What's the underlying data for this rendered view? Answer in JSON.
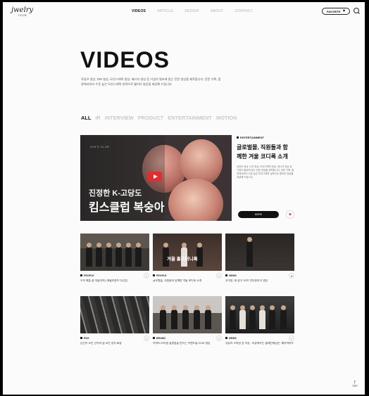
{
  "nav": {
    "logo": "jwelry",
    "logo_sub": "CLUB",
    "items": [
      "VIDEOS",
      "ARTICLE",
      "DESIGN",
      "ABOUT",
      "CONTACT"
    ],
    "active": "VIDEOS",
    "favorite_label": "FAVORITE",
    "favorite_icon": "heart-icon",
    "search_icon": "search-icon"
  },
  "hero": {
    "title": "VIDEOS",
    "description": "유튜브 영상, DID 영상, 모션그래픽 영상, 메시지 영상 등 기업의 필요에 맞는 전문 영상을 제작합니다. 전문 기획, 촬영에서부터 수준 높은 모션그래픽 실력으로 퀄리티 영상을 제공해 드립니다."
  },
  "filters": [
    "ALL",
    "IR",
    "INTERVIEW",
    "PRODUCT",
    "ENTERTAINMENT",
    "MOTION"
  ],
  "featured": {
    "thumb_brand": "KIM'S CLUB",
    "caption_line1": "진정한 K-고당도",
    "caption_line2": "킴스클럽 복숭아",
    "category": "ENTERTAINMENT",
    "title": "글로벌몰, 직원들과 함께한 겨울 코디룩 소개",
    "description": "유튜브 영상, DID 영상, 모션그래픽 영상, 메시지 영상 등 기업의 필요에 맞는 전문 영상을 제작합니다. 전문 기획, 촬영에서부터 수준 높은 모션그래픽 실력으로 퀄리티 영상을 제공해 드립니다.",
    "more_label": "MORE",
    "play_icon": "play-icon",
    "like_icon": "heart-icon"
  },
  "cards": [
    {
      "category": "PEOPLE",
      "title": "우리 제품 잘 아뜰리에 | 애슐리퀸즈 다산점",
      "liked": false
    },
    {
      "category": "PEOPLE",
      "title": "글로벌몰, 직원들과 함께한 겨울 코디룩 소개",
      "liked": false,
      "overlay": "겨울 홀드머니룩"
    },
    {
      "category": "NEWS",
      "title": "루이뷰, 새 광고 '모자' 인터뷰하고 영상",
      "liked": true
    },
    {
      "category": "ESG",
      "title": "당신이 모인 신이야 힘 모은 정치 효용",
      "liked": false
    },
    {
      "category": "BRAND",
      "title": "이마트/스타필 플랫폼을 만드는 이랜드몰 GOD 영상",
      "liked": false
    },
    {
      "category": "NEWS",
      "title": "유튜브 스마일 승 이상 - 리뷰해주는 플래턴웨딩인, 제이미터드 비교와 맥락",
      "liked": false
    }
  ],
  "top_label": "TOP"
}
